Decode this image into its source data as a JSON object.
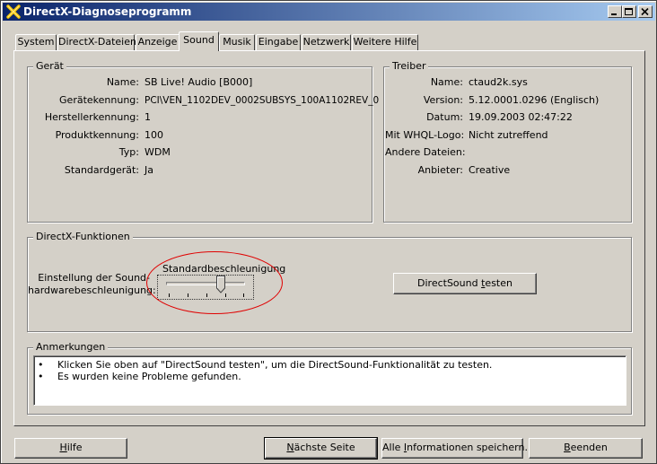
{
  "window": {
    "title": "DirectX-Diagnoseprogramm"
  },
  "tabs": [
    {
      "label": "System"
    },
    {
      "label": "DirectX-Dateien"
    },
    {
      "label": "Anzeige"
    },
    {
      "label": "Sound"
    },
    {
      "label": "Musik"
    },
    {
      "label": "Eingabe"
    },
    {
      "label": "Netzwerk"
    },
    {
      "label": "Weitere Hilfe"
    }
  ],
  "active_tab": "Sound",
  "device": {
    "title": "Gerät",
    "rows": [
      {
        "label": "Name:",
        "value": "SB Live! Audio [B000]"
      },
      {
        "label": "Gerätekennung:",
        "value": "PCI\\VEN_1102DEV_0002SUBSYS_100A1102REV_0"
      },
      {
        "label": "Herstellerkennung:",
        "value": "1"
      },
      {
        "label": "Produktkennung:",
        "value": "100"
      },
      {
        "label": "Typ:",
        "value": "WDM"
      },
      {
        "label": "Standardgerät:",
        "value": "Ja"
      }
    ]
  },
  "driver": {
    "title": "Treiber",
    "rows": [
      {
        "label": "Name:",
        "value": "ctaud2k.sys"
      },
      {
        "label": "Version:",
        "value": "5.12.0001.0296 (Englisch)"
      },
      {
        "label": "Datum:",
        "value": "19.09.2003 02:47:22"
      },
      {
        "label": "Mit WHQL-Logo:",
        "value": "Nicht zutreffend"
      },
      {
        "label": "Andere Dateien:",
        "value": ""
      },
      {
        "label": "Anbieter:",
        "value": "Creative"
      }
    ]
  },
  "directx": {
    "title": "DirectX-Funktionen",
    "accel_label_line1": "Einstellung der Sound-",
    "accel_label_line2": "hardwarebeschleunigung:",
    "slider_caption": "Standardbeschleunigung",
    "slider_level": 0.7,
    "test_button_prefix": "DirectSound ",
    "test_button_accel": "t",
    "test_button_suffix": "esten"
  },
  "notes": {
    "title": "Anmerkungen",
    "items": [
      {
        "bullet": "•",
        "text": "Klicken Sie oben auf \"DirectSound testen\", um die DirectSound-Funktionalität zu testen."
      },
      {
        "bullet": "•",
        "text": "Es wurden keine Probleme gefunden."
      }
    ]
  },
  "buttons": {
    "help": {
      "accel": "H",
      "rest": "ilfe"
    },
    "next": {
      "accel": "N",
      "rest": "ächste Seite"
    },
    "save_info": {
      "pre": "Alle ",
      "accel": "I",
      "rest": "nformationen speichern..."
    },
    "exit": {
      "accel": "B",
      "rest": "eenden"
    }
  }
}
